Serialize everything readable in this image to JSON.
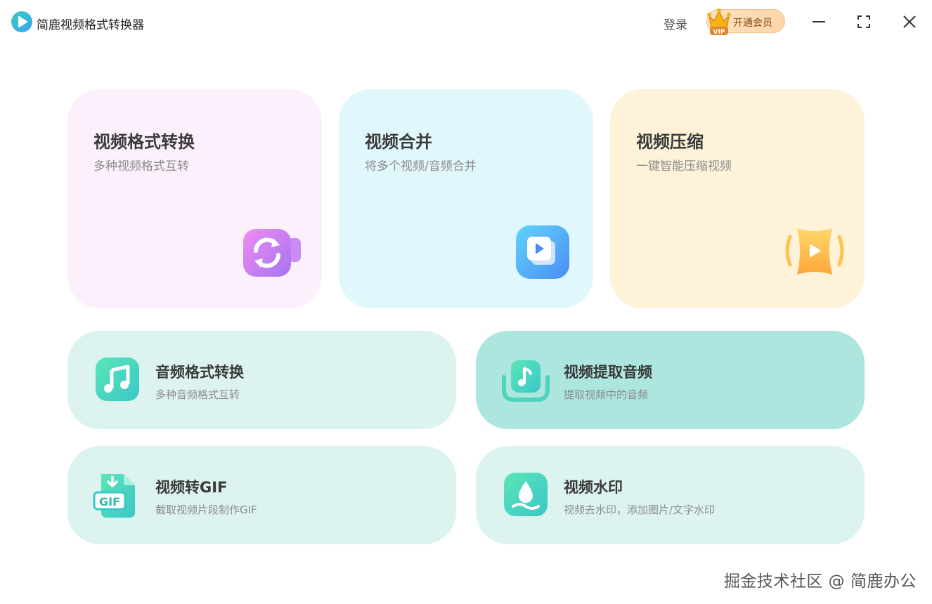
{
  "app": {
    "title": "简鹿视频格式转换器"
  },
  "header": {
    "login_label": "登录",
    "vip_label": "开通会员",
    "vip_badge": "VIP"
  },
  "window_controls": {
    "icons": [
      "minimize-icon",
      "maximize-icon",
      "close-icon"
    ]
  },
  "features_top": [
    {
      "title": "视频格式转换",
      "desc": "多种视频格式互转",
      "icon": "convert-video-icon",
      "bg": "#fcf0fd"
    },
    {
      "title": "视频合并",
      "desc": "将多个视频/音频合并",
      "icon": "merge-video-icon",
      "bg": "#e0f7fc"
    },
    {
      "title": "视频压缩",
      "desc": "一键智能压缩视频",
      "icon": "compress-video-icon",
      "bg": "#fef3d9"
    }
  ],
  "features_bottom": [
    {
      "title": "音频格式转换",
      "desc": "多种音频格式互转",
      "icon": "music-note-icon",
      "bg": "#dcf3ef"
    },
    {
      "title": "视频提取音频",
      "desc": "提取视频中的音频",
      "icon": "extract-audio-icon",
      "bg": "#ace6df"
    },
    {
      "title": "视频转GIF",
      "desc": "截取视频片段制作GIF",
      "icon": "gif-file-icon",
      "bg": "#dcf3ef",
      "icon_text": "GIF"
    },
    {
      "title": "视频水印",
      "desc": "视频去水印，添加图片/文字水印",
      "icon": "watermark-drop-icon",
      "bg": "#dcf3ef"
    }
  ],
  "footer": {
    "watermark": "掘金技术社区 @ 简鹿办公"
  },
  "colors": {
    "accent": "#36c9b0",
    "vip_text": "#8a4b17"
  }
}
